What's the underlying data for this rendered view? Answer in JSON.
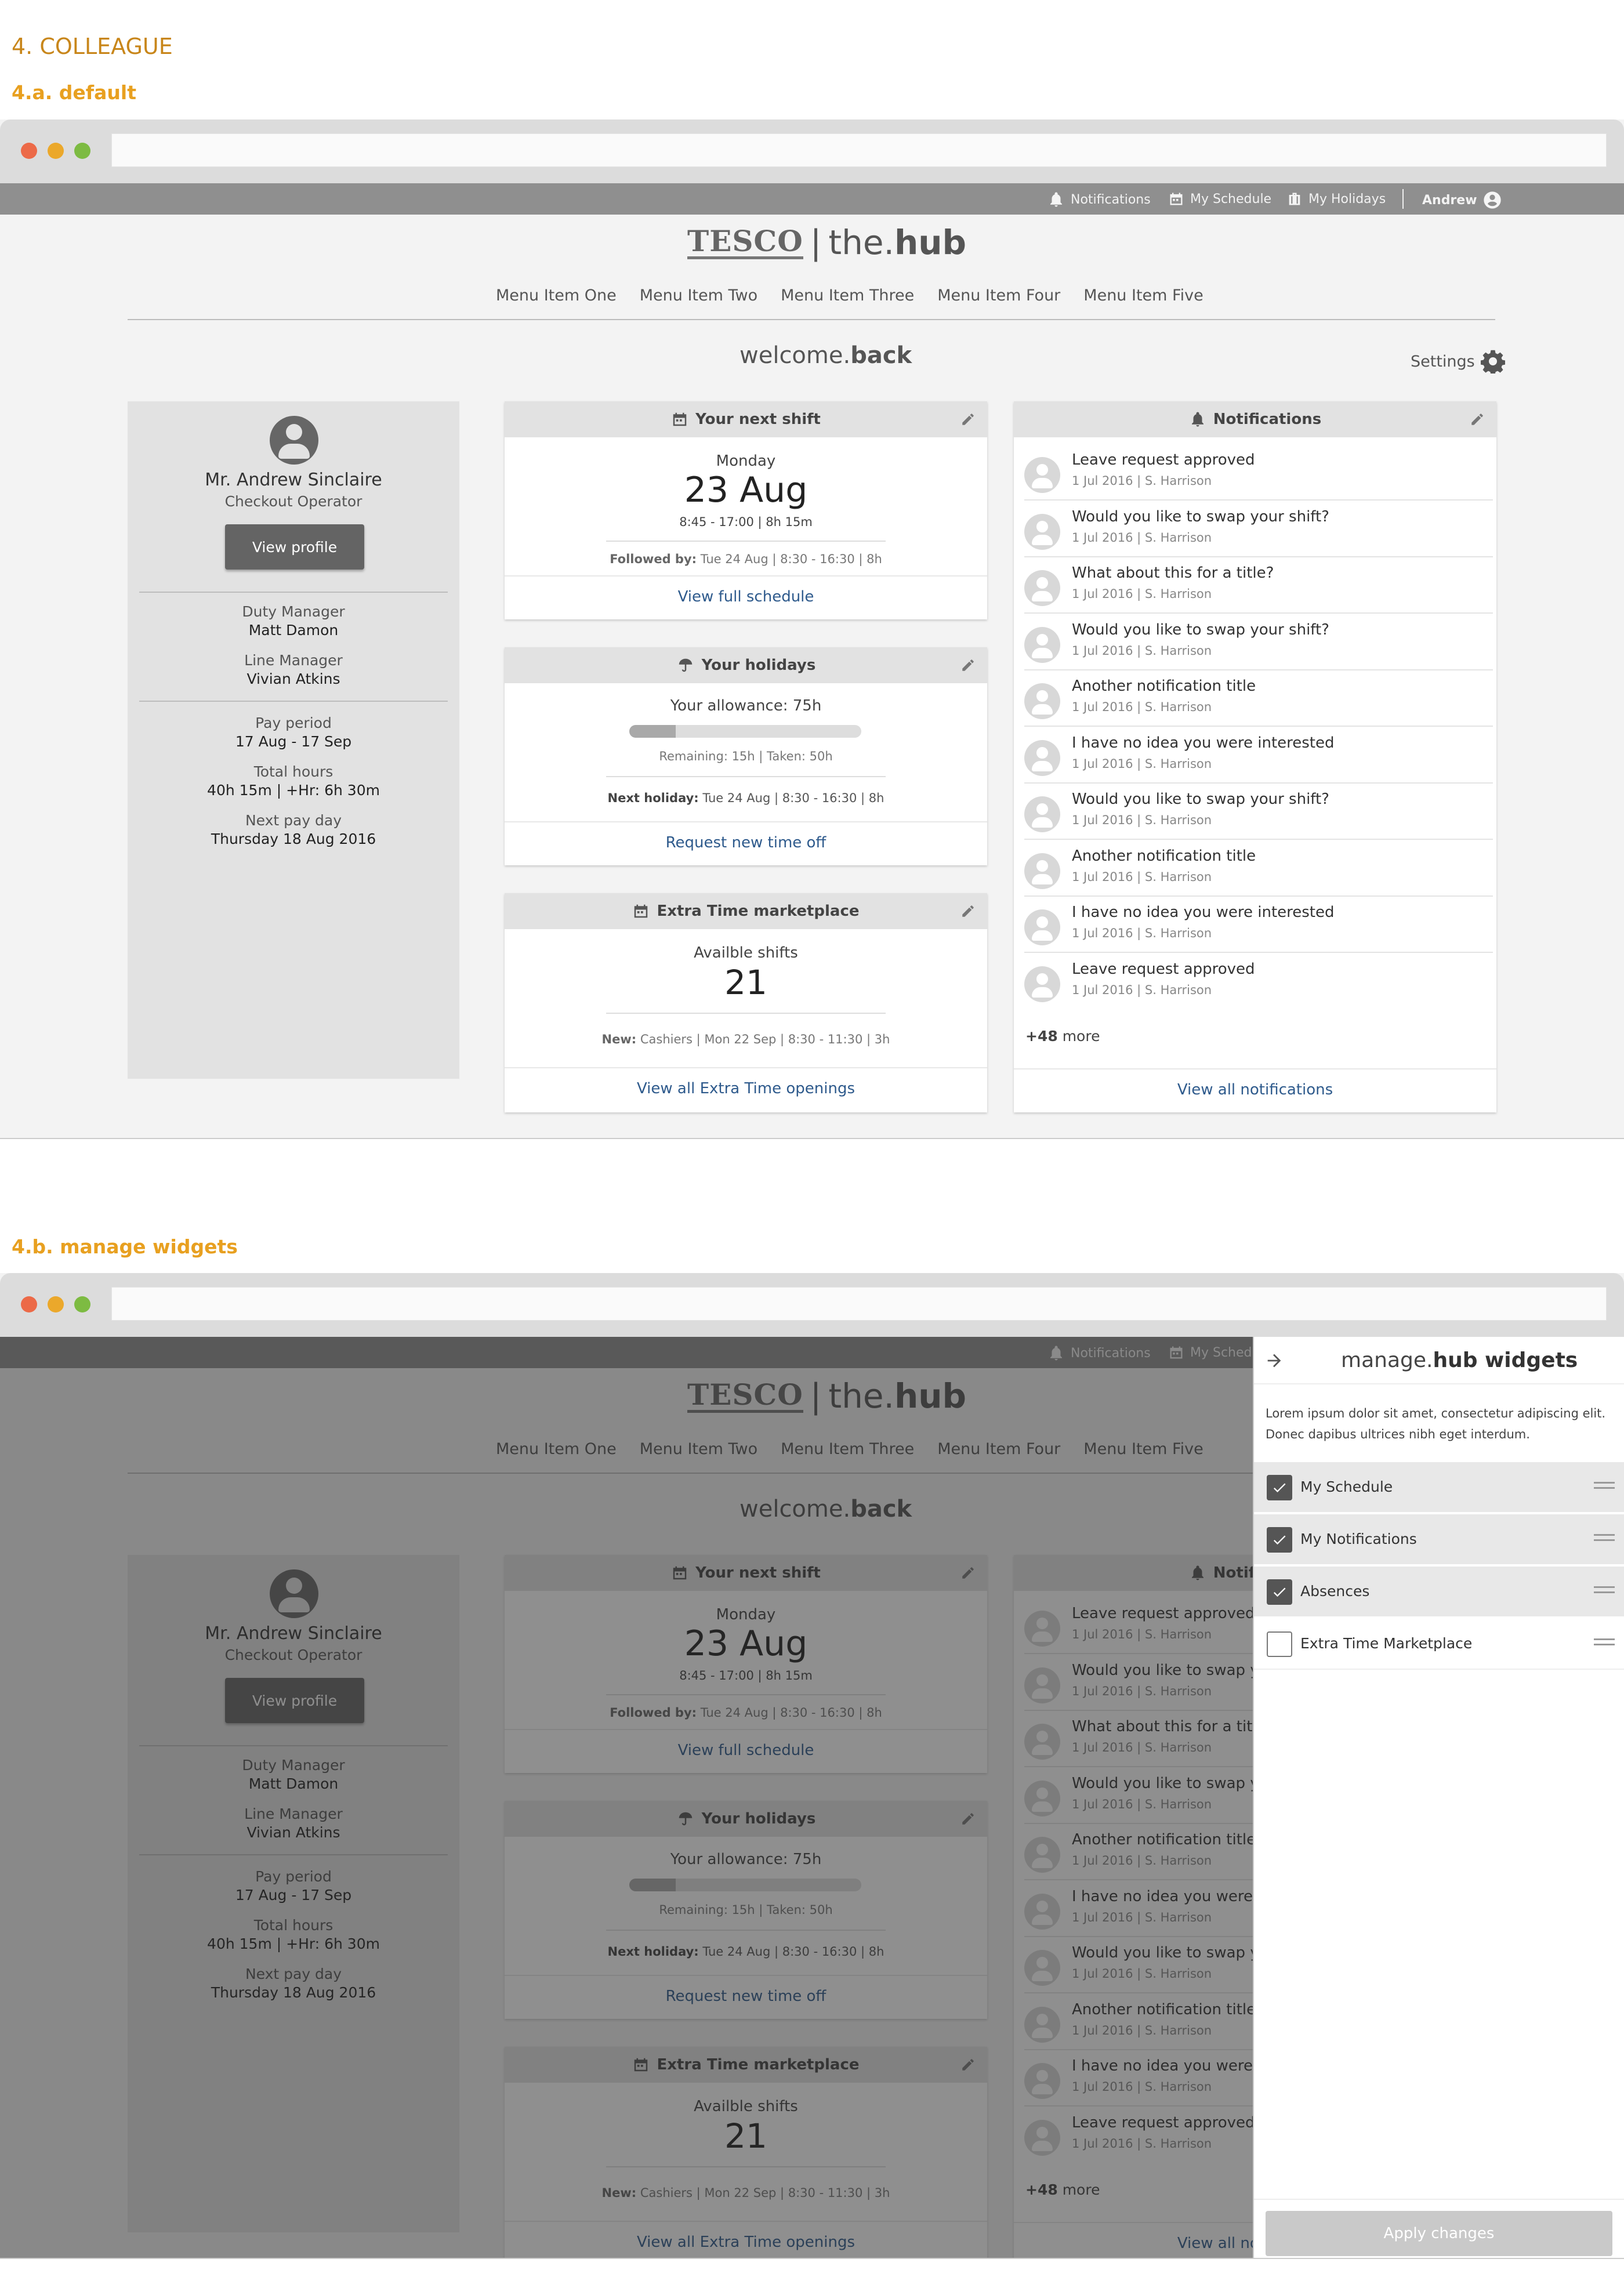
{
  "doc": {
    "title": "4. COLLEAGUE",
    "section_a": "4.a. default",
    "section_b": "4.b. manage widgets"
  },
  "topbar": {
    "notifications": "Notifications",
    "schedule": "My Schedule",
    "holidays": "My Holidays",
    "user": "Andrew"
  },
  "brand": {
    "tesco": "TESCO",
    "sep": "|",
    "the": "the.",
    "hub": "hub"
  },
  "nav": [
    "Menu Item One",
    "Menu Item Two",
    "Menu Item Three",
    "Menu Item Four",
    "Menu Item Five"
  ],
  "welcome": {
    "pre": "welcome.",
    "bold": "back"
  },
  "settings": "Settings",
  "profile": {
    "name": "Mr. Andrew Sinclaire",
    "role": "Checkout Operator",
    "button": "View profile",
    "duty_label": "Duty Manager",
    "duty_value": "Matt Damon",
    "line_label": "Line Manager",
    "line_value": "Vivian Atkins",
    "pay_label": "Pay period",
    "pay_value": "17 Aug - 17 Sep",
    "hours_label": "Total hours",
    "hours_value": "40h 15m | +Hr: 6h 30m",
    "payday_label": "Next pay day",
    "payday_value": "Thursday 18 Aug 2016"
  },
  "shift": {
    "title": "Your next shift",
    "day": "Monday",
    "date": "23 Aug",
    "time": "8:45 - 17:00 | 8h 15m",
    "followed_label": "Followed by:",
    "followed_value": " Tue 24 Aug | 8:30 - 16:30 | 8h",
    "link": "View full schedule"
  },
  "holidays": {
    "title": "Your holidays",
    "allowance": "Your allowance: 75h",
    "progress": 0.2,
    "remaining": "Remaining: 15h | Taken: 50h",
    "next_label": "Next holiday:",
    "next_value": " Tue 24 Aug | 8:30 - 16:30 | 8h",
    "link": "Request new time off"
  },
  "extra": {
    "title": "Extra Time marketplace",
    "label": "Availble shifts",
    "count": "21",
    "new_label": "New:",
    "new_value": " Cashiers | Mon 22 Sep | 8:30 - 11:30 | 3h",
    "link": "View all Extra Time openings"
  },
  "notifications": {
    "title": "Notifications",
    "items": [
      {
        "title": "Leave request approved",
        "meta": "1 Jul 2016 | S. Harrison"
      },
      {
        "title": "Would you like to swap your shift?",
        "meta": "1 Jul 2016 | S. Harrison"
      },
      {
        "title": "What about this for a title?",
        "meta": "1 Jul 2016 | S. Harrison"
      },
      {
        "title": "Would you like to swap your shift?",
        "meta": "1 Jul 2016 | S. Harrison"
      },
      {
        "title": "Another notification title",
        "meta": "1 Jul 2016 | S. Harrison"
      },
      {
        "title": "I have no idea you were interested",
        "meta": "1 Jul 2016 | S. Harrison"
      },
      {
        "title": "Would you like to swap your shift?",
        "meta": "1 Jul 2016 | S. Harrison"
      },
      {
        "title": "Another notification title",
        "meta": "1 Jul 2016 | S. Harrison"
      },
      {
        "title": "I have no idea you were interested",
        "meta": "1 Jul 2016 | S. Harrison"
      },
      {
        "title": "Leave request approved",
        "meta": "1 Jul 2016 | S. Harrison"
      }
    ],
    "more_count": "+48",
    "more_word": " more",
    "link": "View all notifications"
  },
  "manage": {
    "title_pre": "manage.",
    "title_bold": "hub widgets",
    "description": "Lorem ipsum dolor sit amet, consectetur adipiscing elit. Donec dapibus ultrices nibh eget interdum.",
    "widgets": [
      {
        "label": "My Schedule",
        "checked": true
      },
      {
        "label": "My Notifications",
        "checked": true
      },
      {
        "label": "Absences",
        "checked": true
      },
      {
        "label": "Extra Time Marketplace",
        "checked": false
      }
    ],
    "apply": "Apply changes"
  },
  "icons": [
    "bell-icon",
    "calendar-icon",
    "suitcase-icon",
    "user-icon",
    "gear-icon",
    "pencil-icon",
    "umbrella-icon",
    "arrow-right-icon",
    "check-icon",
    "drag-handle-icon"
  ],
  "colors": {
    "heading": "#c8861a",
    "subheading": "#e8a020",
    "link": "#2e5a8c",
    "topbar": "#8f8f8f"
  }
}
